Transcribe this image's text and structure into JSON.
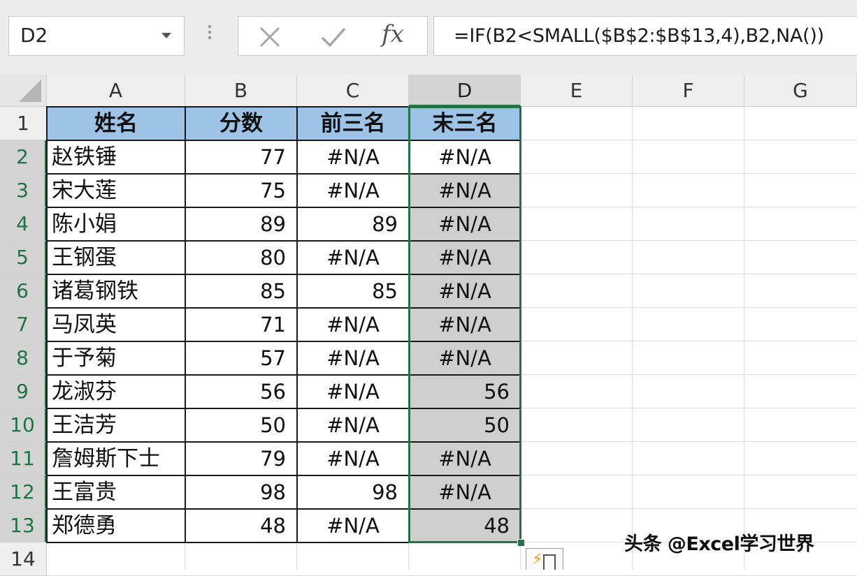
{
  "formula_bar": {
    "name_box": "D2",
    "insert_function_label": "fx",
    "formula": "=IF(B2<SMALL($B$2:$B$13,4),B2,NA())"
  },
  "columns": [
    "A",
    "B",
    "C",
    "D",
    "E",
    "F",
    "G"
  ],
  "rows": [
    "1",
    "2",
    "3",
    "4",
    "5",
    "6",
    "7",
    "8",
    "9",
    "10",
    "11",
    "12",
    "13",
    "14"
  ],
  "table": {
    "headers": [
      "姓名",
      "分数",
      "前三名",
      "末三名"
    ],
    "rows": [
      {
        "name": "赵铁锤",
        "score": "77",
        "top3": "#N/A",
        "bottom3": "#N/A"
      },
      {
        "name": "宋大莲",
        "score": "75",
        "top3": "#N/A",
        "bottom3": "#N/A"
      },
      {
        "name": "陈小娟",
        "score": "89",
        "top3": "89",
        "bottom3": "#N/A"
      },
      {
        "name": "王钢蛋",
        "score": "80",
        "top3": "#N/A",
        "bottom3": "#N/A"
      },
      {
        "name": "诸葛钢铁",
        "score": "85",
        "top3": "85",
        "bottom3": "#N/A"
      },
      {
        "name": "马凤英",
        "score": "71",
        "top3": "#N/A",
        "bottom3": "#N/A"
      },
      {
        "name": "于予菊",
        "score": "57",
        "top3": "#N/A",
        "bottom3": "#N/A"
      },
      {
        "name": "龙淑芬",
        "score": "56",
        "top3": "#N/A",
        "bottom3": "56"
      },
      {
        "name": "王洁芳",
        "score": "50",
        "top3": "#N/A",
        "bottom3": "50"
      },
      {
        "name": "詹姆斯下士",
        "score": "79",
        "top3": "#N/A",
        "bottom3": "#N/A"
      },
      {
        "name": "王富贵",
        "score": "98",
        "top3": "98",
        "bottom3": "#N/A"
      },
      {
        "name": "郑德勇",
        "score": "48",
        "top3": "#N/A",
        "bottom3": "48"
      }
    ]
  },
  "colors": {
    "header_fill": "#9dc3e6",
    "selection_border": "#217346",
    "selected_fill": "#cfcfcf"
  },
  "watermark": "头条 @Excel学习世界"
}
